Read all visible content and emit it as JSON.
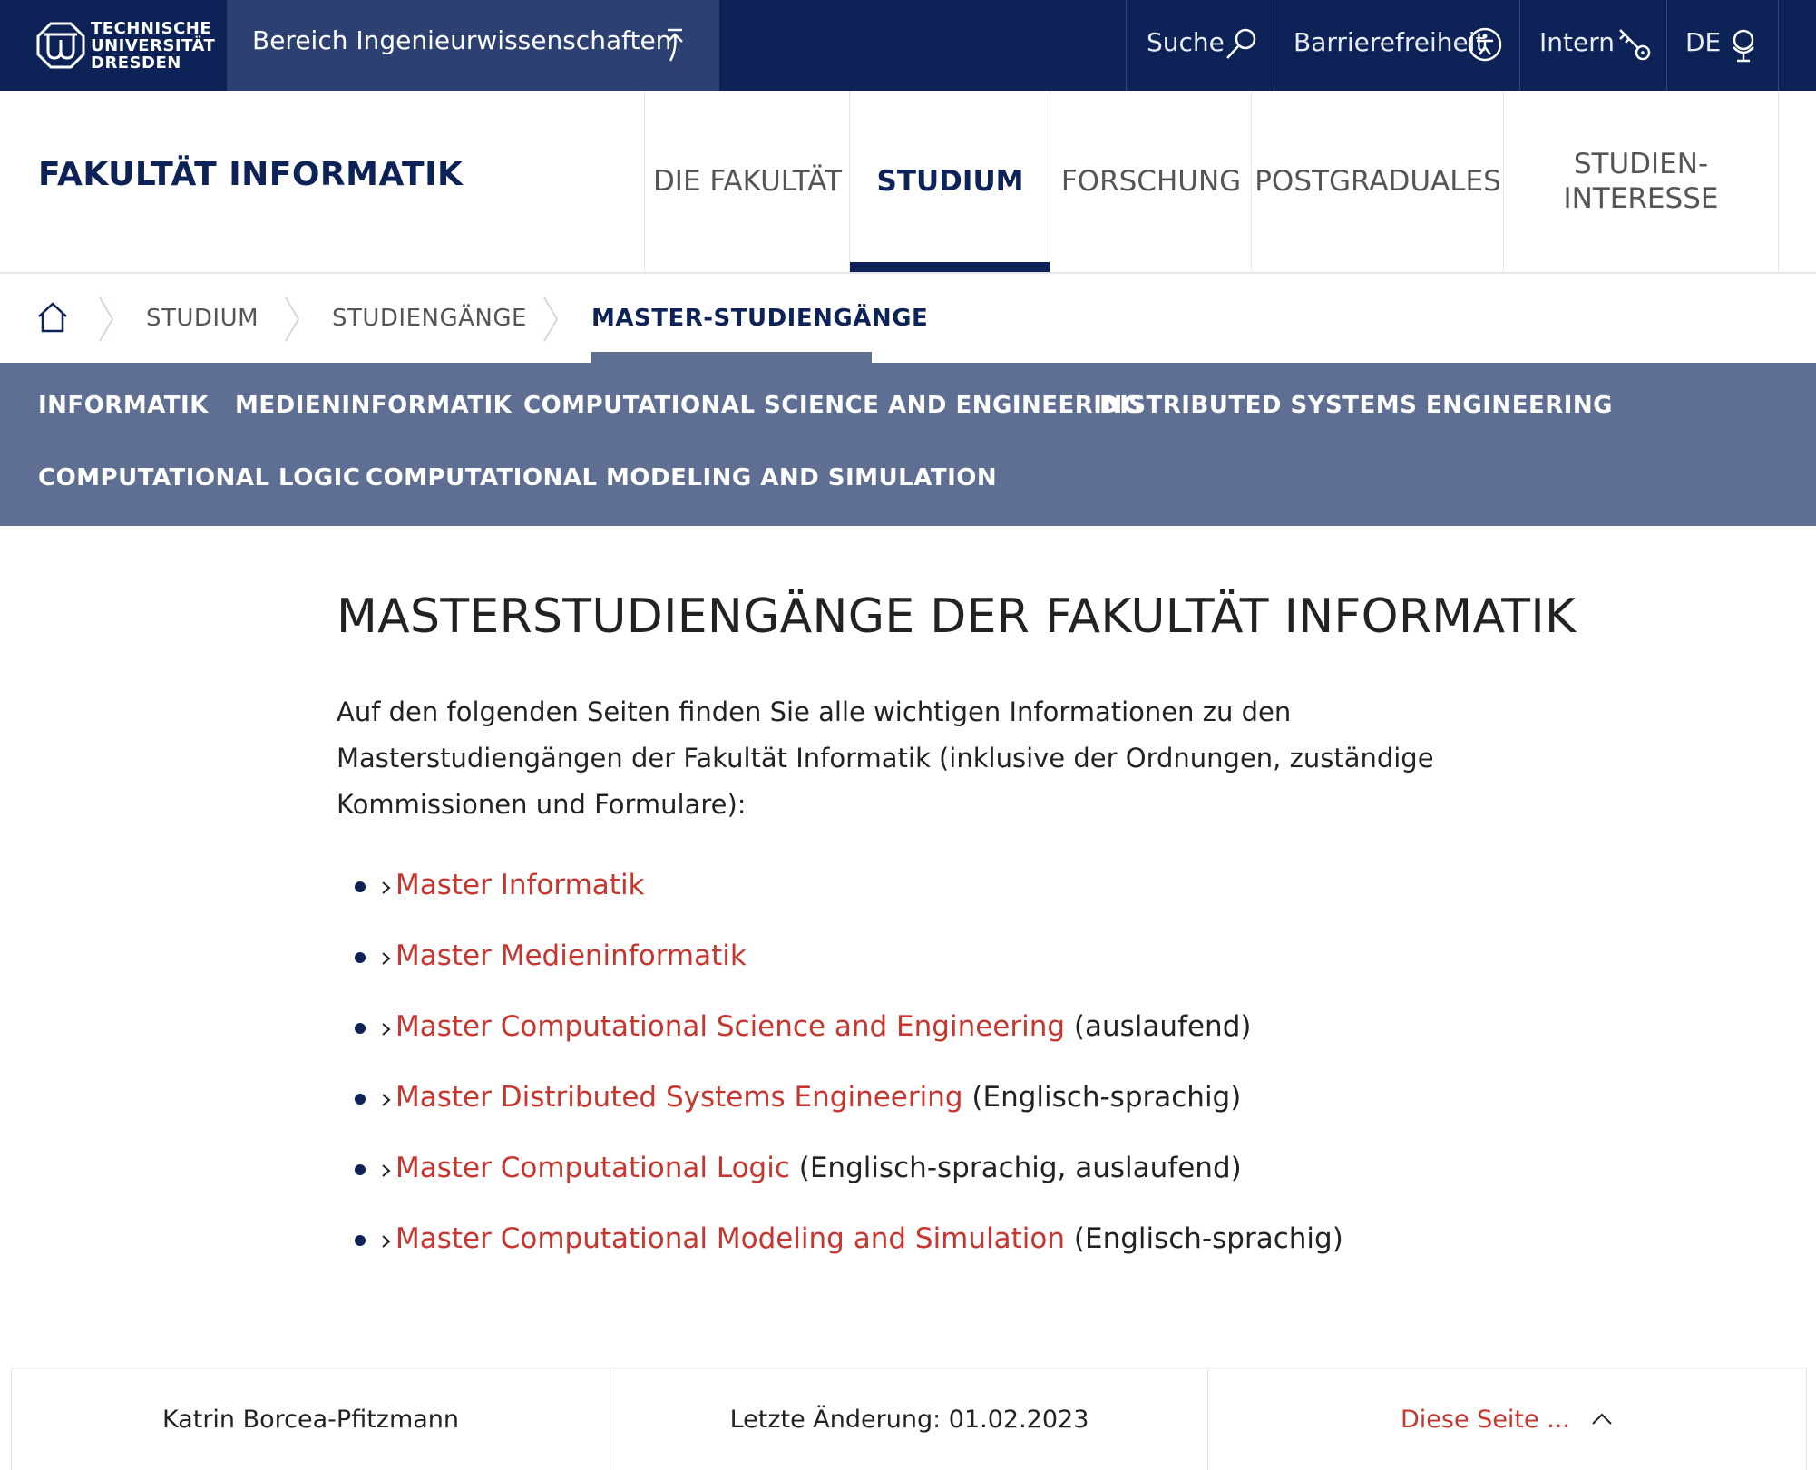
{
  "topbar": {
    "logo_lines": [
      "TECHNISCHE",
      "UNIVERSITÄT",
      "DRESDEN"
    ],
    "bereich_label": "Bereich Ingenieurwissenschaften",
    "utilities": [
      {
        "label": "Suche",
        "icon": "search-icon"
      },
      {
        "label": "Barrierefreiheit",
        "icon": "accessibility-icon"
      },
      {
        "label": "Intern",
        "icon": "key-icon"
      },
      {
        "label": "DE",
        "icon": "globe-icon"
      }
    ]
  },
  "header": {
    "faculty": "FAKULTÄT INFORMATIK",
    "nav": [
      {
        "label": "DIE FAKULTÄT",
        "active": false
      },
      {
        "label": "STUDIUM",
        "active": true
      },
      {
        "label": "FORSCHUNG",
        "active": false
      },
      {
        "label": "POSTGRADUALES",
        "active": false
      },
      {
        "label": "STUDIEN-\nINTERESSE",
        "active": false
      }
    ]
  },
  "breadcrumb": {
    "items": [
      "STUDIUM",
      "STUDIENGÄNGE",
      "MASTER-STUDIENGÄNGE"
    ]
  },
  "subnav": {
    "items": [
      "INFORMATIK",
      "MEDIENINFORMATIK",
      "COMPUTATIONAL SCIENCE AND ENGINEERING",
      "DISTRIBUTED SYSTEMS ENGINEERING",
      "COMPUTATIONAL LOGIC",
      "COMPUTATIONAL MODELING AND SIMULATION"
    ]
  },
  "content": {
    "title": "MASTERSTUDIENGÄNGE DER FAKULTÄT INFORMATIK",
    "intro": "Auf den folgenden Seiten finden Sie alle wichtigen Informationen zu den Masterstudiengängen der Fakultät Informatik (inklusive der Ordnungen, zuständige Kommissionen und Formulare):",
    "links": [
      {
        "label": "Master Informatik",
        "note": ""
      },
      {
        "label": "Master Medieninformatik",
        "note": ""
      },
      {
        "label": "Master Computational Science and Engineering",
        "note": " (auslaufend)"
      },
      {
        "label": "Master Distributed Systems Engineering",
        "note": " (Englisch-sprachig)"
      },
      {
        "label": "Master Computational Logic",
        "note": " (Englisch-sprachig, auslaufend)"
      },
      {
        "label": "Master Computational Modeling and Simulation",
        "note": " (Englisch-sprachig)"
      }
    ]
  },
  "footer": {
    "author": "Katrin Borcea-Pfitzmann",
    "last_change": "Letzte Änderung: 01.02.2023",
    "page_menu": "Diese Seite ..."
  },
  "colors": {
    "navy": "#0d2357",
    "bereich_bg": "#2c4071",
    "subnav_bg": "#5f6f93",
    "link_red": "#c8352e"
  }
}
